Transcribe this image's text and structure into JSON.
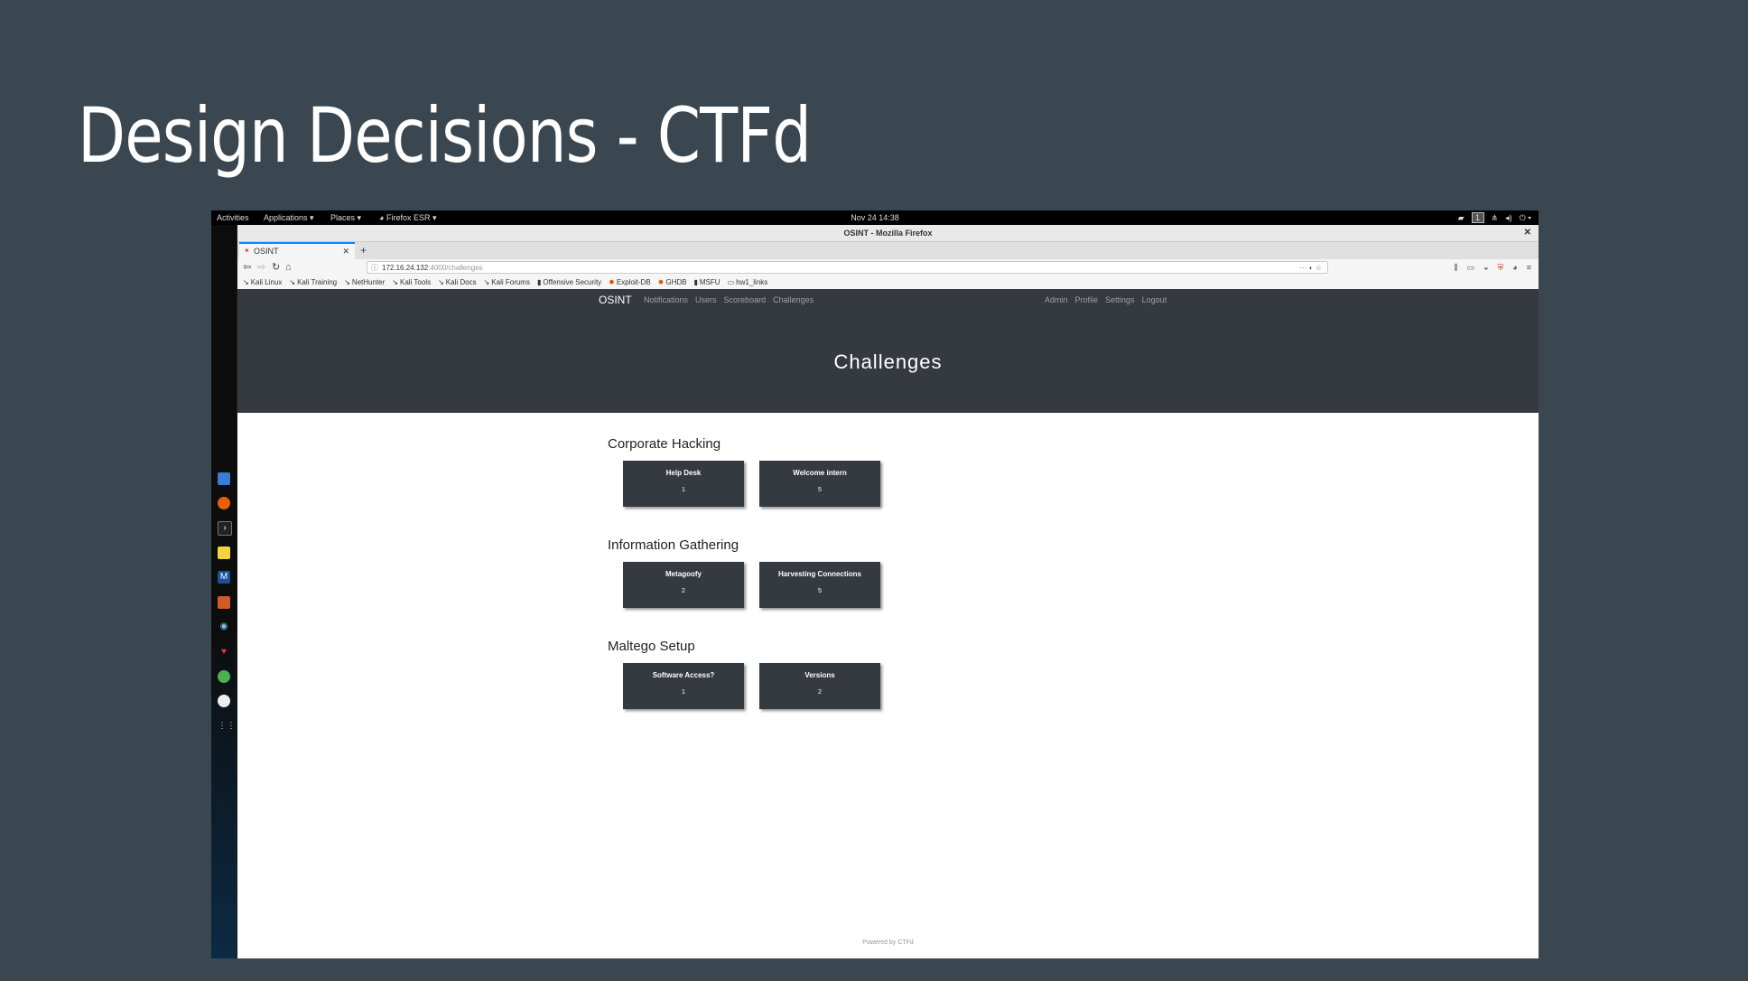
{
  "slide": {
    "title": "Design Decisions - CTFd"
  },
  "gnome": {
    "activities": "Activities",
    "applications": "Applications ▾",
    "places": "Places ▾",
    "firefox": "Firefox ESR ▾",
    "clock": "Nov 24  14:38",
    "workspace": "1"
  },
  "firefox": {
    "window_title": "OSINT - Mozilla Firefox",
    "tab_title": "OSINT",
    "url_host": "172.16.24.132",
    "url_path": ":4000/challenges",
    "bookmarks": [
      "Kali Linux",
      "Kali Training",
      "NetHunter",
      "Kali Tools",
      "Kali Docs",
      "Kali Forums",
      "Offensive Security",
      "Exploit-DB",
      "GHDB",
      "MSFU",
      "hw1_links"
    ]
  },
  "ctfd": {
    "brand": "OSINT",
    "nav_left": [
      "Notifications",
      "Users",
      "Scoreboard",
      "Challenges"
    ],
    "nav_right": [
      "Admin",
      "Profile",
      "Settings",
      "Logout"
    ],
    "page_title": "Challenges",
    "categories": [
      {
        "name": "Corporate Hacking",
        "challenges": [
          {
            "name": "Help Desk",
            "value": "1"
          },
          {
            "name": "Welcome intern",
            "value": "5"
          }
        ]
      },
      {
        "name": "Information Gathering",
        "challenges": [
          {
            "name": "Metagoofy",
            "value": "2"
          },
          {
            "name": "Harvesting Connections",
            "value": "5"
          }
        ]
      },
      {
        "name": "Maltego Setup",
        "challenges": [
          {
            "name": "Software Access?",
            "value": "1"
          },
          {
            "name": "Versions",
            "value": "2"
          }
        ]
      }
    ],
    "footer": "Powered by CTFd"
  }
}
